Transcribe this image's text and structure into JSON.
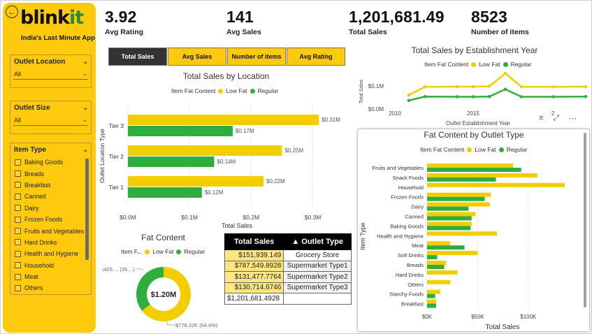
{
  "brand": {
    "logo_main": "blink",
    "logo_accent": "it",
    "tagline": "India's Last Minute App"
  },
  "sidebar": {
    "outlet_location": {
      "label": "Outlet Location",
      "value": "All"
    },
    "outlet_size": {
      "label": "Outlet Size",
      "value": "All"
    },
    "item_type": {
      "label": "Item Type",
      "items": [
        "Baking Goods",
        "Breads",
        "Breakfast",
        "Canned",
        "Dairy",
        "Frozen Foods",
        "Fruits and Vegetables",
        "Hard Drinks",
        "Health and Hygiene",
        "Household",
        "Meat",
        "Others"
      ]
    }
  },
  "kpis": [
    {
      "value": "3.92",
      "label": "Avg Rating"
    },
    {
      "value": "141",
      "label": "Avg Sales"
    },
    {
      "value": "1,201,681.49",
      "label": "Total Sales"
    },
    {
      "value": "8523",
      "label": "Number of items"
    }
  ],
  "tabs": [
    "Total Sales",
    "Avg Sales",
    "Number of items",
    "Avg Rating"
  ],
  "legend": {
    "title": "Item Fat Content",
    "title_short": "Item F...",
    "low": "Low Fat",
    "regular": "Regular"
  },
  "colors": {
    "accent": "#FFC90E",
    "low_fat": "#F2CD00",
    "regular": "#2EAE3E",
    "dark": "#333333"
  },
  "chart_data": [
    {
      "type": "bar",
      "title": "Total Sales by Location",
      "orientation": "horizontal",
      "categories": [
        "Tier 3",
        "Tier 2",
        "Tier 1"
      ],
      "series": [
        {
          "name": "Low Fat",
          "values": [
            0.31,
            0.25,
            0.22
          ],
          "labels": [
            "$0.31M",
            "$0.25M",
            "$0.22M"
          ]
        },
        {
          "name": "Regular",
          "values": [
            0.17,
            0.14,
            0.12
          ],
          "labels": [
            "$0.17M",
            "$0.14M",
            "$0.12M"
          ]
        }
      ],
      "xticks": [
        "$0.0M",
        "$0.1M",
        "$0.2M",
        "$0.3M"
      ],
      "xlim": [
        0,
        0.33
      ],
      "xlabel": "Total Sales",
      "ylabel": "Outlet Location Type"
    },
    {
      "type": "line",
      "title": "Total Sales by Establishment Year",
      "x": [
        2011,
        2012,
        2014,
        2015,
        2016,
        2017,
        2018,
        2020,
        2022
      ],
      "series": [
        {
          "name": "Low Fat",
          "values": [
            0.08,
            0.127,
            0.128,
            0.128,
            0.13,
            0.204,
            0.127,
            0.127,
            0.128
          ]
        },
        {
          "name": "Regular",
          "values": [
            0.049,
            0.071,
            0.07,
            0.07,
            0.071,
            0.113,
            0.07,
            0.07,
            0.071
          ]
        }
      ],
      "xticks": [
        "2010",
        "2015",
        "2"
      ],
      "yticks": [
        "$0.0M",
        "$0.1M"
      ],
      "xlabel": "Outlet Establishment Year",
      "ylabel": "Total Sales"
    },
    {
      "type": "pie",
      "title": "Fat Content",
      "center_label": "$1.20M",
      "slices": [
        {
          "name": "Low Fat",
          "value": 776.32,
          "label": "$776.32K (64.6%)"
        },
        {
          "name": "Regular",
          "value": 425.36,
          "label": "$425.... (35....)"
        }
      ]
    },
    {
      "type": "bar",
      "title": "Fat Content by Outlet Type",
      "orientation": "horizontal",
      "categories": [
        "Fruits and Vegetables",
        "Snack Foods",
        "Household",
        "Frozen Foods",
        "Dairy",
        "Canned",
        "Baking Goods",
        "Health and Hygiene",
        "Meat",
        "Soft Drinks",
        "Breads",
        "Hard Drinks",
        "Others",
        "Starchy Foods",
        "Breakfast"
      ],
      "series": [
        {
          "name": "Low Fat",
          "values": [
            85,
            109,
            136,
            63,
            62,
            48,
            44,
            69,
            23,
            50,
            19,
            30,
            23,
            13,
            9
          ]
        },
        {
          "name": "Regular",
          "values": [
            93,
            68,
            0,
            57,
            41,
            44,
            43,
            0,
            37,
            10,
            17,
            0,
            0,
            8,
            9
          ]
        }
      ],
      "xticks": [
        "$0K",
        "$50K",
        "$100K"
      ],
      "xlim": [
        0,
        145
      ],
      "xlabel": "Total Sales",
      "ylabel": "Item Type"
    },
    {
      "type": "table",
      "columns": [
        "Total Sales",
        "Outlet Type"
      ],
      "rows": [
        [
          "$151,939.149",
          "Grocery Store"
        ],
        [
          "$787,549.8928",
          "Supermarket Type1"
        ],
        [
          "$131,477.7764",
          "Supermarket Type2"
        ],
        [
          "$130,714.6746",
          "Supermarket Type3"
        ]
      ],
      "total": "$1,201,681.4928"
    }
  ],
  "toolbar": {
    "count": "2"
  }
}
